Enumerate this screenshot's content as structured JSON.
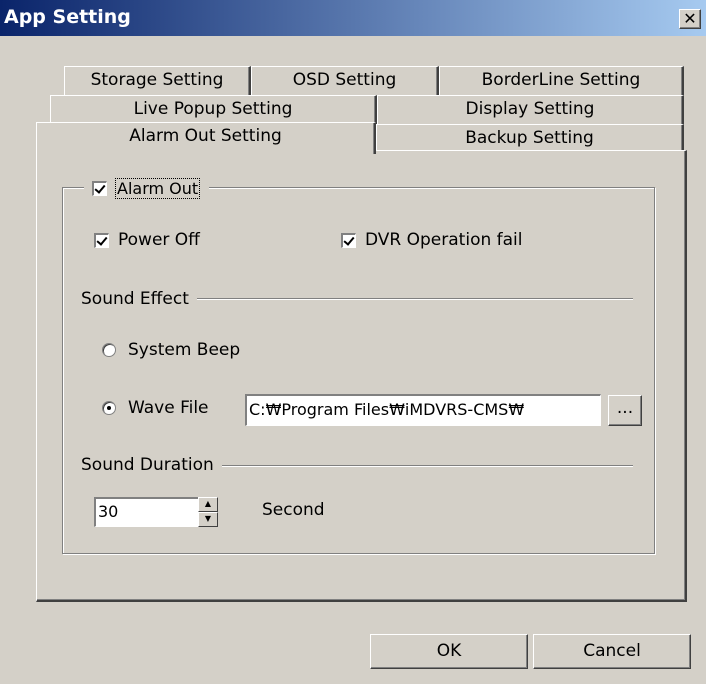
{
  "window": {
    "title": "App Setting",
    "close_glyph": "✕"
  },
  "tabs": {
    "row1": [
      "Storage Setting",
      "OSD Setting",
      "BorderLine Setting"
    ],
    "row2": [
      "Live Popup Setting",
      "Display Setting"
    ],
    "row3": [
      "Alarm Out Setting",
      "Backup Setting"
    ],
    "selected": "Alarm Out Setting"
  },
  "alarm": {
    "group_label": "Alarm Out",
    "group_checked": true,
    "power_off_label": "Power Off",
    "power_off_checked": true,
    "dvr_fail_label": "DVR Operation fail",
    "dvr_fail_checked": true
  },
  "sound_effect": {
    "label": "Sound Effect",
    "system_beep_label": "System Beep",
    "wave_file_label": "Wave File",
    "selected": "Wave File",
    "wave_file_path": "C:₩Program Files₩iMDVRS-CMS₩",
    "browse_label": "..."
  },
  "sound_duration": {
    "label": "Sound Duration",
    "value": "30",
    "unit": "Second"
  },
  "buttons": {
    "ok": "OK",
    "cancel": "Cancel"
  }
}
